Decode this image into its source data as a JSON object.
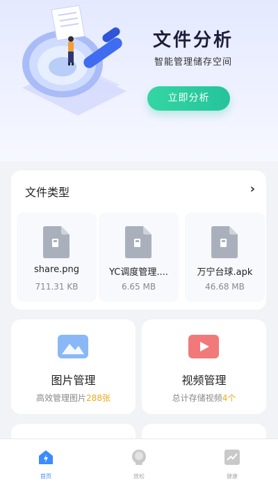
{
  "hero": {
    "title": "文件分析",
    "subtitle": "智能管理储存空间",
    "button_label": "立即分析"
  },
  "file_types": {
    "title": "文件类型",
    "more_icon": "chevron-right-icon",
    "files": [
      {
        "name": "share.png",
        "size": "711.31 KB"
      },
      {
        "name": "YC调度管理....",
        "size": "6.65 MB"
      },
      {
        "name": "万宁台球.apk",
        "size": "46.68 MB"
      }
    ]
  },
  "features": [
    {
      "title": "图片管理",
      "desc_prefix": "高效管理图片",
      "count": "288张",
      "icon": "image-icon",
      "icon_color": "#7fb0f5"
    },
    {
      "title": "视频管理",
      "desc_prefix": "总计存储视频",
      "count": "4个",
      "icon": "video-play-icon",
      "icon_color": "#f27070"
    }
  ],
  "nav": [
    {
      "label": "首页",
      "icon": "home-bolt-icon",
      "active": true
    },
    {
      "label": "放松",
      "icon": "relax-face-icon",
      "active": false
    },
    {
      "label": "健康",
      "icon": "health-chart-icon",
      "active": false
    }
  ],
  "colors": {
    "accent_green": "#26c39b",
    "highlight": "#f0a81a",
    "nav_active": "#3a8cff"
  }
}
